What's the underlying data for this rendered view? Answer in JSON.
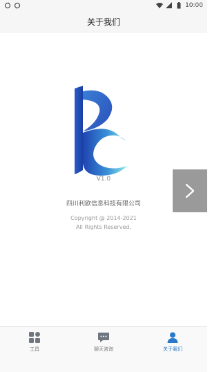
{
  "status_bar": {
    "time": "10:00",
    "left_icons": [
      "sync-icon",
      "sync-icon"
    ],
    "right_icons": [
      "wifi-icon",
      "signal-icon",
      "battery-icon"
    ]
  },
  "header": {
    "title": "关于我们"
  },
  "about": {
    "version": "V1.0",
    "company": "四川利欧信息科技有限公司",
    "copyright_line1": "Copyright @ 2014-2021",
    "copyright_line2": "All Rights Reserved."
  },
  "side_button": {
    "icon": "chevron-right-icon"
  },
  "tabs": [
    {
      "label": "工具",
      "icon": "grid-icon",
      "active": false
    },
    {
      "label": "聊天咨询",
      "icon": "chat-icon",
      "active": false
    },
    {
      "label": "关于我们",
      "icon": "person-icon",
      "active": true
    }
  ],
  "colors": {
    "accent": "#2a78c8",
    "logo_dark": "#1b3fa6",
    "logo_light": "#7fe3e6"
  }
}
